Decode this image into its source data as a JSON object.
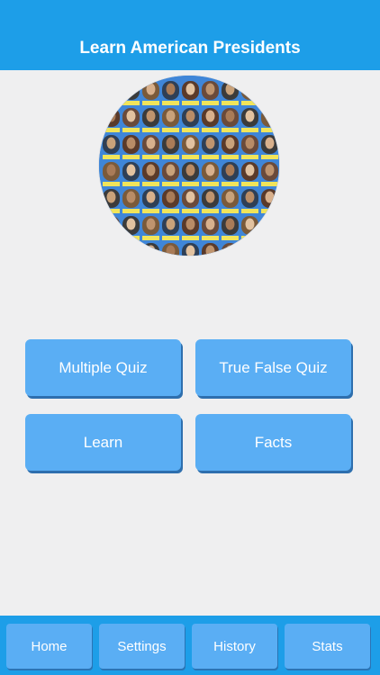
{
  "header": {
    "title": "Learn American Presidents"
  },
  "hero": {
    "icon": "presidents-portraits-image"
  },
  "menu": {
    "multiple_quiz": "Multiple Quiz",
    "true_false_quiz": "True False Quiz",
    "learn": "Learn",
    "facts": "Facts"
  },
  "tabs": [
    "Home",
    "Settings",
    "History",
    "Stats"
  ],
  "colors": {
    "primary": "#1d9ee8",
    "button": "#5aaef4",
    "background": "#efeff0"
  }
}
